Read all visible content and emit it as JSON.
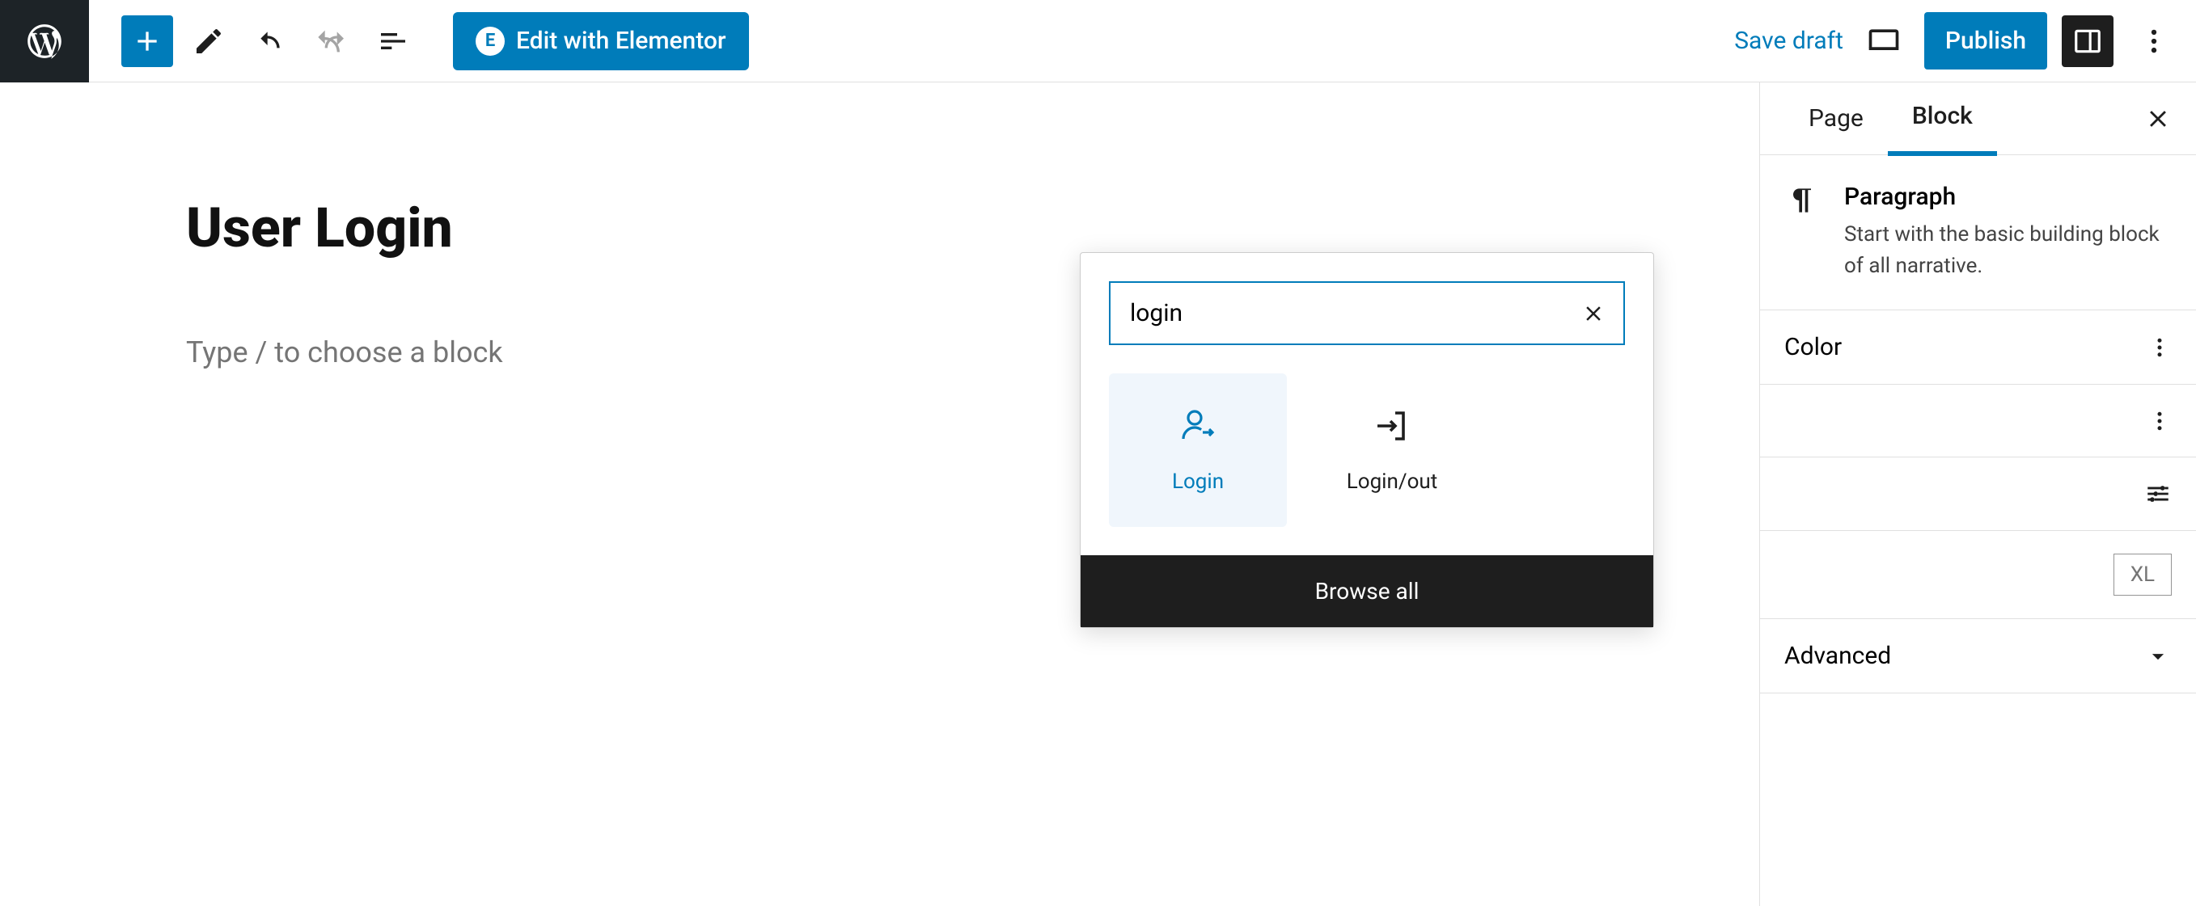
{
  "toolbar": {
    "elementor_label": "Edit with Elementor",
    "save_draft": "Save draft",
    "publish": "Publish"
  },
  "canvas": {
    "title": "User Login",
    "placeholder": "Type / to choose a block"
  },
  "sidebar": {
    "tabs": {
      "page": "Page",
      "block": "Block"
    },
    "block_info": {
      "title": "Paragraph",
      "description": "Start with the basic building block of all narrative."
    },
    "panels": {
      "color": "Color",
      "size_xl": "XL",
      "advanced": "Advanced"
    }
  },
  "inserter": {
    "search_value": "login",
    "results": [
      {
        "label": "Login",
        "active": true
      },
      {
        "label": "Login/out",
        "active": false
      }
    ],
    "browse_all": "Browse all"
  }
}
